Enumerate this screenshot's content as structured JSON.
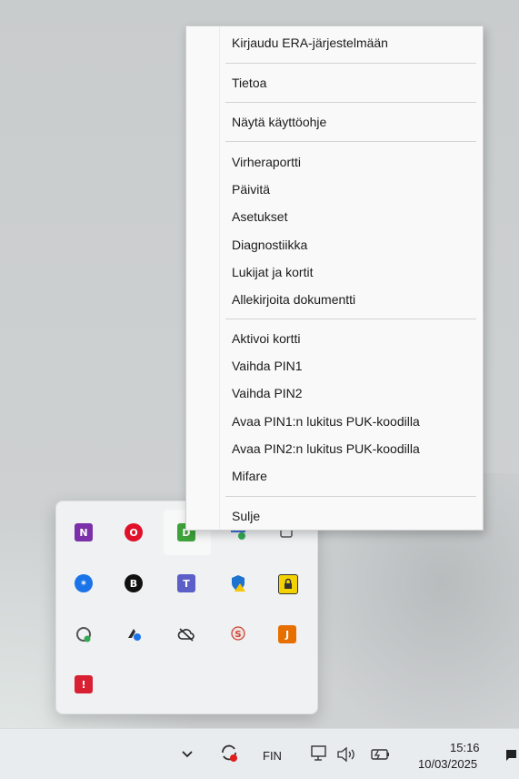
{
  "context_menu": {
    "items": [
      "Kirjaudu ERA-järjestelmään",
      "Tietoa",
      "Näytä käyttöohje",
      "Virheraportti",
      "Päivitä",
      "Asetukset",
      "Diagnostiikka",
      "Lukijat ja kortit",
      "Allekirjoita dokumentti",
      "Aktivoi kortti",
      "Vaihda PIN1",
      "Vaihda PIN2",
      "Avaa PIN1:n lukitus PUK-koodilla",
      "Avaa PIN2:n lukitus PUK-koodilla",
      "Mifare",
      "Sulje"
    ]
  },
  "tray_flyout": {
    "icons": [
      {
        "name": "onenote-icon",
        "glyph": "N",
        "color": "#7b2fa8"
      },
      {
        "name": "opera-icon",
        "glyph": "O",
        "color": "#e0102b"
      },
      {
        "name": "card-reader-app-icon",
        "glyph": "D",
        "color": "#3fa33b"
      },
      {
        "name": "network-shield-icon",
        "glyph": "",
        "color": "#3b6fd1"
      },
      {
        "name": "device-icon",
        "glyph": "",
        "color": "#9a9a9a"
      },
      {
        "name": "bluetooth-icon",
        "glyph": "B",
        "color": "#1a73e8"
      },
      {
        "name": "b-app-icon",
        "glyph": "B",
        "color": "#111111"
      },
      {
        "name": "teams-icon",
        "glyph": "T",
        "color": "#5b5fc7"
      },
      {
        "name": "security-warning-icon",
        "glyph": "!",
        "color": "#1e73d1"
      },
      {
        "name": "lock-icon",
        "glyph": "",
        "color": "#3a3a3a"
      },
      {
        "name": "sync-icon",
        "glyph": "",
        "color": "#5a5a5a"
      },
      {
        "name": "app-update-icon",
        "glyph": "",
        "color": "#2b2b2b"
      },
      {
        "name": "cloud-off-icon",
        "glyph": "",
        "color": "#2b2b2b"
      },
      {
        "name": "certificate-icon",
        "glyph": "S",
        "color": "#c9463d"
      },
      {
        "name": "java-icon",
        "glyph": "J",
        "color": "#e76f00"
      },
      {
        "name": "alert-app-icon",
        "glyph": "!",
        "color": "#d92032"
      }
    ]
  },
  "taskbar": {
    "language": "FIN",
    "time": "15:16",
    "date": "10/03/2025"
  },
  "icons": {
    "chevron": "chevron-down-icon",
    "volume": "volume-icon",
    "battery": "battery-icon",
    "monitor": "monitor-icon"
  }
}
